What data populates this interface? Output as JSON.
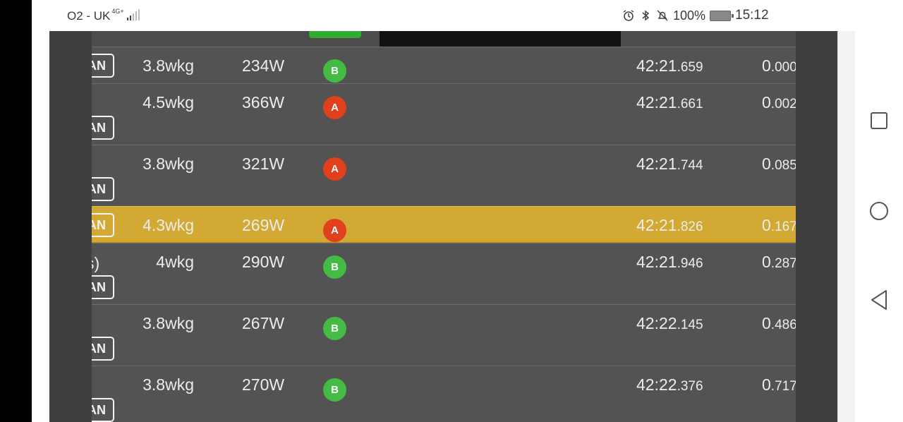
{
  "status_bar": {
    "carrier": "O2 - UK",
    "network": "4G+",
    "battery_pct": "100%",
    "time": "15:12"
  },
  "table": {
    "rows": [
      {
        "name_fragment": "",
        "team": "AN",
        "wkg": "3.8wkg",
        "watts": "234W",
        "category": "B",
        "time_main": "42:21",
        "time_ms": ".659",
        "gap_main": "0",
        "gap_ms": ".000",
        "highlight": false
      },
      {
        "name_fragment": "",
        "team": "AN",
        "wkg": "4.5wkg",
        "watts": "366W",
        "category": "A",
        "time_main": "42:21",
        "time_ms": ".661",
        "gap_main": "0",
        "gap_ms": ".002",
        "highlight": false
      },
      {
        "name_fragment": "",
        "team": "AN",
        "wkg": "3.8wkg",
        "watts": "321W",
        "category": "A",
        "time_main": "42:21",
        "time_ms": ".744",
        "gap_main": "0",
        "gap_ms": ".085",
        "highlight": false
      },
      {
        "name_fragment": "",
        "team": "AN",
        "wkg": "4.3wkg",
        "watts": "269W",
        "category": "A",
        "time_main": "42:21",
        "time_ms": ".826",
        "gap_main": "0",
        "gap_ms": ".167",
        "highlight": true
      },
      {
        "name_fragment": "s)",
        "team": "AN",
        "wkg": "4wkg",
        "watts": "290W",
        "category": "B",
        "time_main": "42:21",
        "time_ms": ".946",
        "gap_main": "0",
        "gap_ms": ".287",
        "highlight": false
      },
      {
        "name_fragment": "",
        "team": "AN",
        "wkg": "3.8wkg",
        "watts": "267W",
        "category": "B",
        "time_main": "42:22",
        "time_ms": ".145",
        "gap_main": "0",
        "gap_ms": ".486",
        "highlight": false
      },
      {
        "name_fragment": "",
        "team": "AN",
        "wkg": "3.8wkg",
        "watts": "270W",
        "category": "B",
        "time_main": "42:22",
        "time_ms": ".376",
        "gap_main": "0",
        "gap_ms": ".717",
        "highlight": false
      }
    ]
  },
  "colors": {
    "category_A": "#e0401c",
    "category_B": "#44bb44",
    "highlight_row": "#d1a933"
  },
  "nav_icons": [
    "recent-apps-icon",
    "home-icon",
    "back-icon"
  ]
}
